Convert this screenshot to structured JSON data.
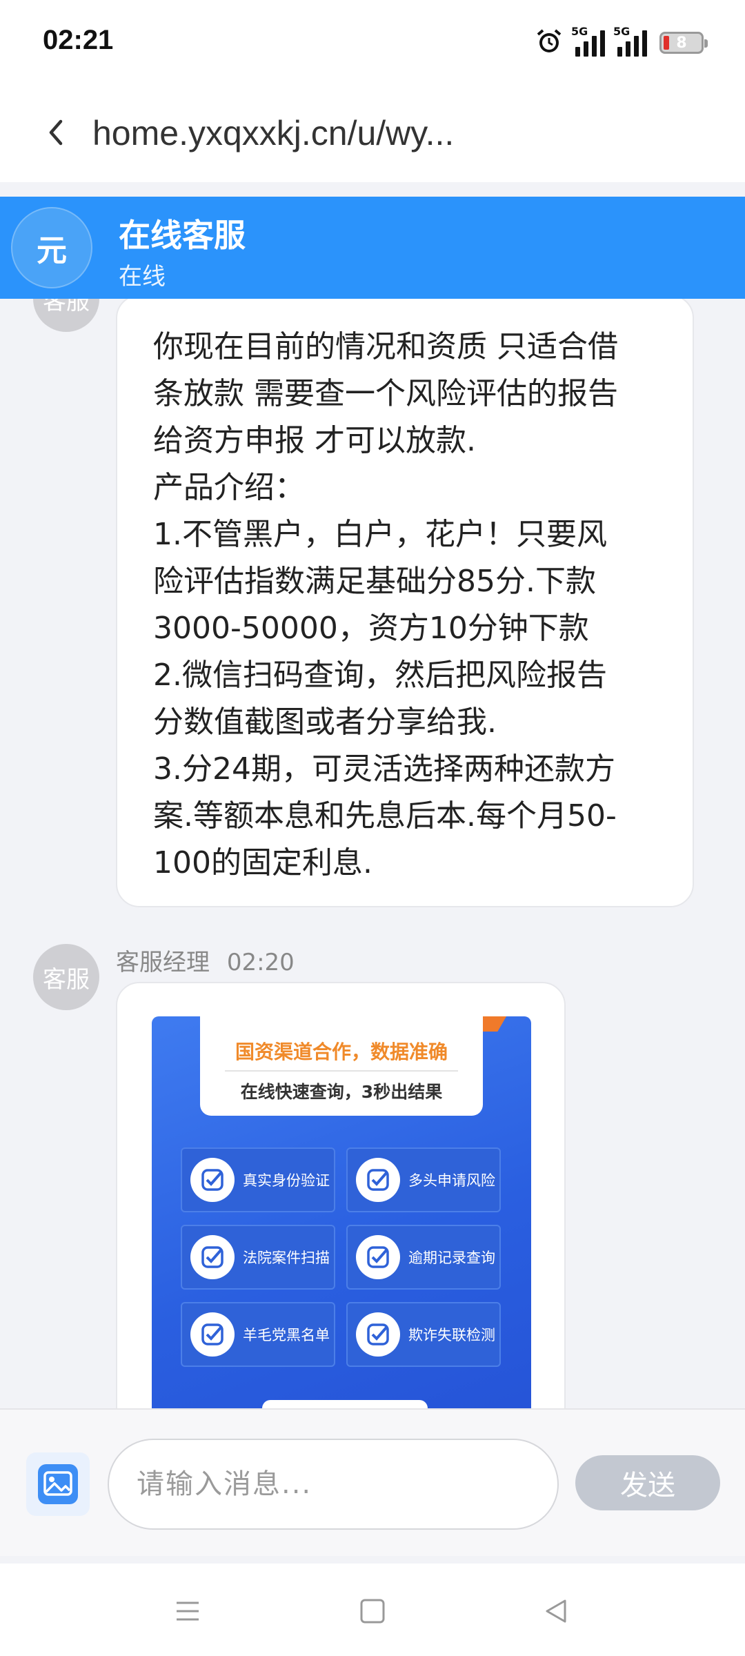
{
  "status_bar": {
    "time": "02:21",
    "signal1_label": "5G",
    "signal2_label": "5G",
    "battery_level": "8",
    "icons": [
      "alarm-icon",
      "signal-icon",
      "signal-icon",
      "battery-icon"
    ]
  },
  "browser": {
    "url": "home.yxqxxkj.cn/u/wy...",
    "back_icon": "chevron-left-icon"
  },
  "chat_header": {
    "avatar_text": "元",
    "title": "在线客服",
    "status": "在线"
  },
  "messages": [
    {
      "avatar_text": "客服",
      "text": "你现在目前的情况和资质 只适合借\n条放款 需要查一个风险评估的报告\n给资方申报 才可以放款.\n产品介绍：\n1.不管黑户，白户，花户！只要风\n险评估指数满足基础分85分.下款\n3000-50000，资方10分钟下款\n2.微信扫码查询，然后把风险报告\n分数值截图或者分享给我.\n3.分24期，可灵活选择两种还款方\n案.等额本息和先息后本.每个月50-\n100的固定利息."
    },
    {
      "avatar_text": "客服",
      "sender": "客服经理",
      "time": "02:20",
      "image": {
        "headline": "国资渠道合作，数据准确",
        "subline": "在线快速查询，3秒出结果",
        "features": [
          "真实身份验证",
          "多头申请风险",
          "法院案件扫描",
          "逾期记录查询",
          "羊毛党黑名单",
          "欺诈失联检测"
        ]
      }
    }
  ],
  "input_bar": {
    "image_button_icon": "image-icon",
    "placeholder": "请输入消息...",
    "send_label": "发送"
  },
  "nav_bar": {
    "icons": [
      "menu-icon",
      "home-square-icon",
      "back-triangle-icon"
    ]
  },
  "colors": {
    "header_blue": "#2b93fb",
    "send_disabled": "#c3c8d1",
    "promo_blue": "#2a5fe0",
    "promo_orange": "#f08a2a"
  }
}
